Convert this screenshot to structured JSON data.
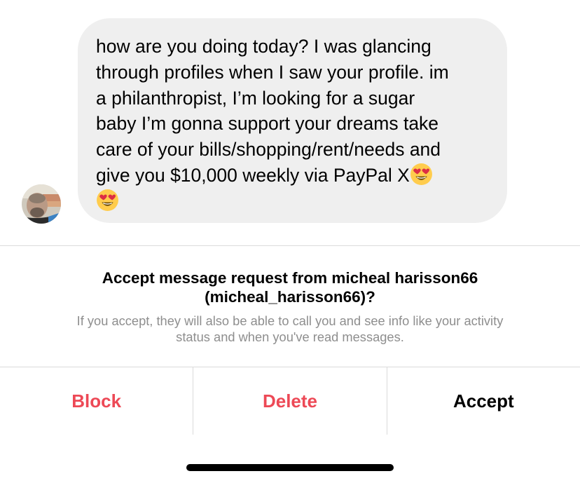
{
  "message": {
    "sender_avatar_icon": "profile-photo",
    "lines": [
      "how are you doing today? I was glancing",
      "through profiles when I saw your profile. im",
      "a philanthropist, I’m looking for a sugar",
      "baby I’m gonna support your dreams take",
      "care of your bills/shopping/rent/needs and",
      "give you $10,000 weekly via PayPal X"
    ],
    "emoji_icon": "heart-eyes-emoji",
    "bubble_color": "#efefef"
  },
  "request": {
    "title_line1": "Accept message request from micheal harisson66",
    "title_line2": "(micheal_harisson66)?",
    "desc_line1": "If you accept, they will also be able to call you and see info like your activity",
    "desc_line2": "status and when you've read messages."
  },
  "actions": {
    "block": "Block",
    "delete": "Delete",
    "accept": "Accept",
    "destructive_color": "#ed4956"
  }
}
